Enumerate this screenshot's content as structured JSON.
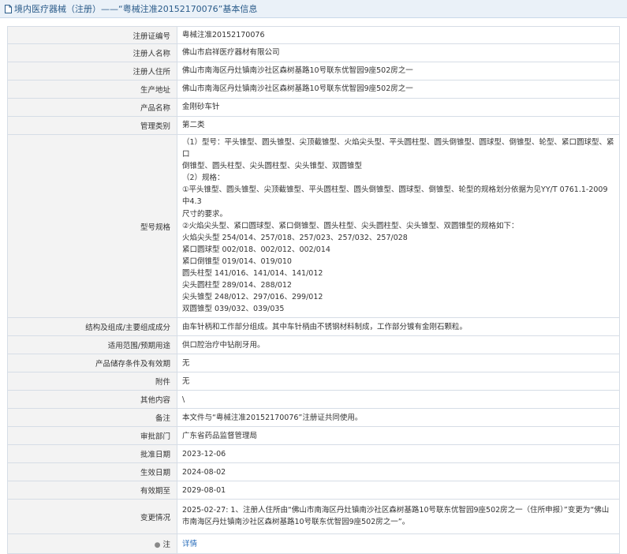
{
  "header": {
    "title": "境内医疗器械（注册）——“粤械注准20152170076”基本信息"
  },
  "rows": {
    "reg_no": {
      "label": "注册证编号",
      "value": "粤械注准20152170076"
    },
    "registrant_name": {
      "label": "注册人名称",
      "value": "佛山市启祥医疗器材有限公司"
    },
    "registrant_addr": {
      "label": "注册人住所",
      "value": "佛山市南海区丹灶镇南沙社区森树基路10号联东优智园9座502房之一"
    },
    "prod_addr": {
      "label": "生产地址",
      "value": "佛山市南海区丹灶镇南沙社区森树基路10号联东优智园9座502房之一"
    },
    "product_name": {
      "label": "产品名称",
      "value": "金刚砂车针"
    },
    "mgmt_class": {
      "label": "管理类别",
      "value": "第二类"
    },
    "model_spec": {
      "label": "型号规格",
      "lines": [
        "（1）型号：平头锥型、圆头锥型、尖顶截锥型、火焰尖头型、平头圆柱型、圆头倒锥型、圆球型、倒锥型、轮型、紧口圆球型、紧口",
        "倒锥型、圆头柱型、尖头圆柱型、尖头锥型、双圆锥型",
        "（2）规格：",
        "①平头锥型、圆头锥型、尖顶截锥型、平头圆柱型、圆头倒锥型、圆球型、倒锥型、轮型的规格划分依据为见YY/T 0761.1-2009中4.3",
        "尺寸的要求。",
        "②火焰尖头型、紧口圆球型、紧口倒锥型、圆头柱型、尖头圆柱型、尖头锥型、双圆锥型的规格如下：",
        "火焰尖头型 254/014、257/018、257/023、257/032、257/028",
        "紧口圆球型 002/018、002/012、002/014",
        "紧口倒锥型 019/014、019/010",
        "圆头柱型 141/016、141/014、141/012",
        "尖头圆柱型 289/014、288/012",
        "尖头锥型 248/012、297/016、299/012",
        "双圆锥型 039/032、039/035"
      ]
    },
    "structure": {
      "label": "结构及组成/主要组成成分",
      "value": "由车针柄和工作部分组成。其中车针柄由不锈钢材料制成，工作部分镀有金刚石颗粒。"
    },
    "scope": {
      "label": "适用范围/预期用途",
      "value": "供口腔治疗中钻削牙用。"
    },
    "storage": {
      "label": "产品储存条件及有效期",
      "value": "无"
    },
    "attachment": {
      "label": "附件",
      "value": "无"
    },
    "other": {
      "label": "其他内容",
      "value": "\\"
    },
    "remark": {
      "label": "备注",
      "value": "本文件与“粤械注准20152170076”注册证共同使用。"
    },
    "approval_dept": {
      "label": "审批部门",
      "value": "广东省药品监督管理局"
    },
    "approval_date": {
      "label": "批准日期",
      "value": "2023-12-06"
    },
    "effective_date": {
      "label": "生效日期",
      "value": "2024-08-02"
    },
    "expiry_date": {
      "label": "有效期至",
      "value": "2029-08-01"
    },
    "changes": {
      "label": "变更情况",
      "lines": [
        "2025-02-27: 1、注册人住所由“佛山市南海区丹灶镇南沙社区森树基路10号联东优智园9座502房之一（住所申报）”变更为“佛山",
        "市南海区丹灶镇南沙社区森树基路10号联东优智园9座502房之一”。"
      ]
    },
    "note": {
      "label": "注",
      "value": "详情",
      "icon": "pin-icon"
    }
  }
}
